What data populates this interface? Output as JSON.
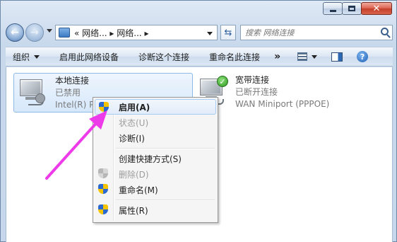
{
  "window": {
    "controls": {
      "minimize": "minimize",
      "maximize": "maximize",
      "close": "close"
    }
  },
  "nav": {
    "breadcrumb": "« 网络... ▸ 网络... ▸",
    "search_placeholder": "搜索 网络连接"
  },
  "toolbar": {
    "organize": "组织",
    "enable_device": "启用此网络设备",
    "diagnose": "诊断这个连接",
    "rename": "重命名此连接",
    "more": "»"
  },
  "connections": [
    {
      "name": "本地连接",
      "status": "已禁用",
      "device": "Intel(R) P"
    },
    {
      "name": "宽带连接",
      "status": "已断开连接",
      "device": "WAN Miniport (PPPOE)"
    }
  ],
  "context_menu": {
    "enable": "启用(A)",
    "status": "状态(U)",
    "diagnose": "诊断(I)",
    "create_shortcut": "创建快捷方式(S)",
    "delete": "删除(D)",
    "rename": "重命名(M)",
    "properties": "属性(R)"
  },
  "colors": {
    "annotation_arrow": "#ee3bea",
    "accent": "#2a6ad0"
  }
}
